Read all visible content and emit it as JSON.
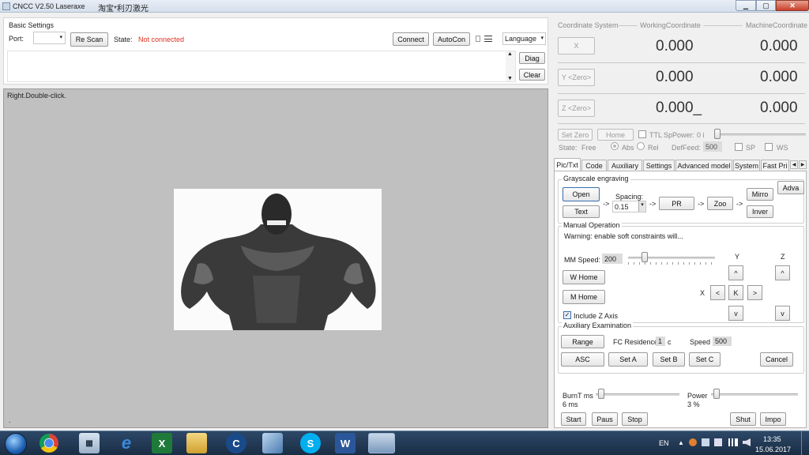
{
  "window": {
    "title": "CNCC V2.50  Laseraxe",
    "title_cn": "淘宝*利刃激光",
    "minimize": "▁",
    "maximize": "▢",
    "close": "✕"
  },
  "basic_settings": {
    "title": "Basic Settings",
    "port_label": "Port:",
    "port_value": "",
    "rescan": "Re Scan",
    "state_label": "State:",
    "state_value": "Not connected",
    "connect": "Connect",
    "autocon": "AutoCon",
    "language": "Language",
    "diag": "Diag",
    "clear": "Clear"
  },
  "canvas": {
    "hint": "Right.Double-click."
  },
  "coords": {
    "coordinate_system": "Coordinate System",
    "working": "WorkingCoordinate",
    "machine": "MachineCoordinate",
    "x_btn": "X",
    "y_btn": "Y <Zero>",
    "z_btn": "Z <Zero>",
    "x_work": "0.000",
    "x_mach": "0.000",
    "y_work": "0.000",
    "y_mach": "0.000",
    "z_work": "0.000_",
    "z_mach": "0.000",
    "set_zero": "Set Zero",
    "home": "Home",
    "ttl": "TTL",
    "sppower_label": "SpPower:",
    "sppower_value": "0 i",
    "state_label": "State:",
    "state_value": "Free",
    "abs": "Abs",
    "rel": "Rel",
    "deffeed_label": "DefFeed:",
    "deffeed_value": "500",
    "sp": "SP",
    "ws": "WS"
  },
  "tabs": [
    "Pic/Txt",
    "Code",
    "Auxiliary",
    "Settings",
    "Advanced model",
    "System",
    "Fast Pri"
  ],
  "grayscale": {
    "title": "Grayscale engraving",
    "open": "Open",
    "text": "Text",
    "spacing_label": "Spacing:",
    "spacing_value": "0.15",
    "pr": "PR",
    "zoo": "Zoo",
    "mirro": "Mirro",
    "inver": "Inver",
    "adva": "Adva",
    "arrow": "->"
  },
  "manual": {
    "title": "Manual Operation",
    "warning": "Warning: enable soft constraints will...",
    "mm_speed_label": "MM  Speed:",
    "mm_speed_value": "200",
    "w_home": "W Home",
    "m_home": "M Home",
    "y_label": "Y",
    "z_label": "Z",
    "x_label": "X",
    "up": "^",
    "down": "v",
    "left": "<",
    "right": ">",
    "center": "K",
    "include_z": "Include Z Axis"
  },
  "aux": {
    "title": "Auxiliary Examination",
    "range": "Range",
    "fc_label": "FC Residence",
    "fc_value": "1",
    "fc_unit": "c",
    "speed_label": "Speed",
    "speed_value": "500",
    "asc": "ASC",
    "set_a": "Set A",
    "set_b": "Set B",
    "set_c": "Set C",
    "cancel": "Cancel"
  },
  "burn": {
    "burnt_label": "BurnT  ms",
    "burnt_value": "6 ms",
    "burnt_fraction": 0.03,
    "power_label": "Power",
    "power_value": "3 %",
    "power_fraction": 0.03,
    "start": "Start",
    "paus": "Paus",
    "stop": "Stop",
    "shut": "Shut",
    "impo": "Impo"
  },
  "taskbar": {
    "lang": "EN",
    "time": "13:35",
    "date": "15.06.2017"
  },
  "colors": {
    "error_text": "#e03020",
    "taskbar": "#1f3550",
    "canvas_bg": "#c0c0c0"
  }
}
